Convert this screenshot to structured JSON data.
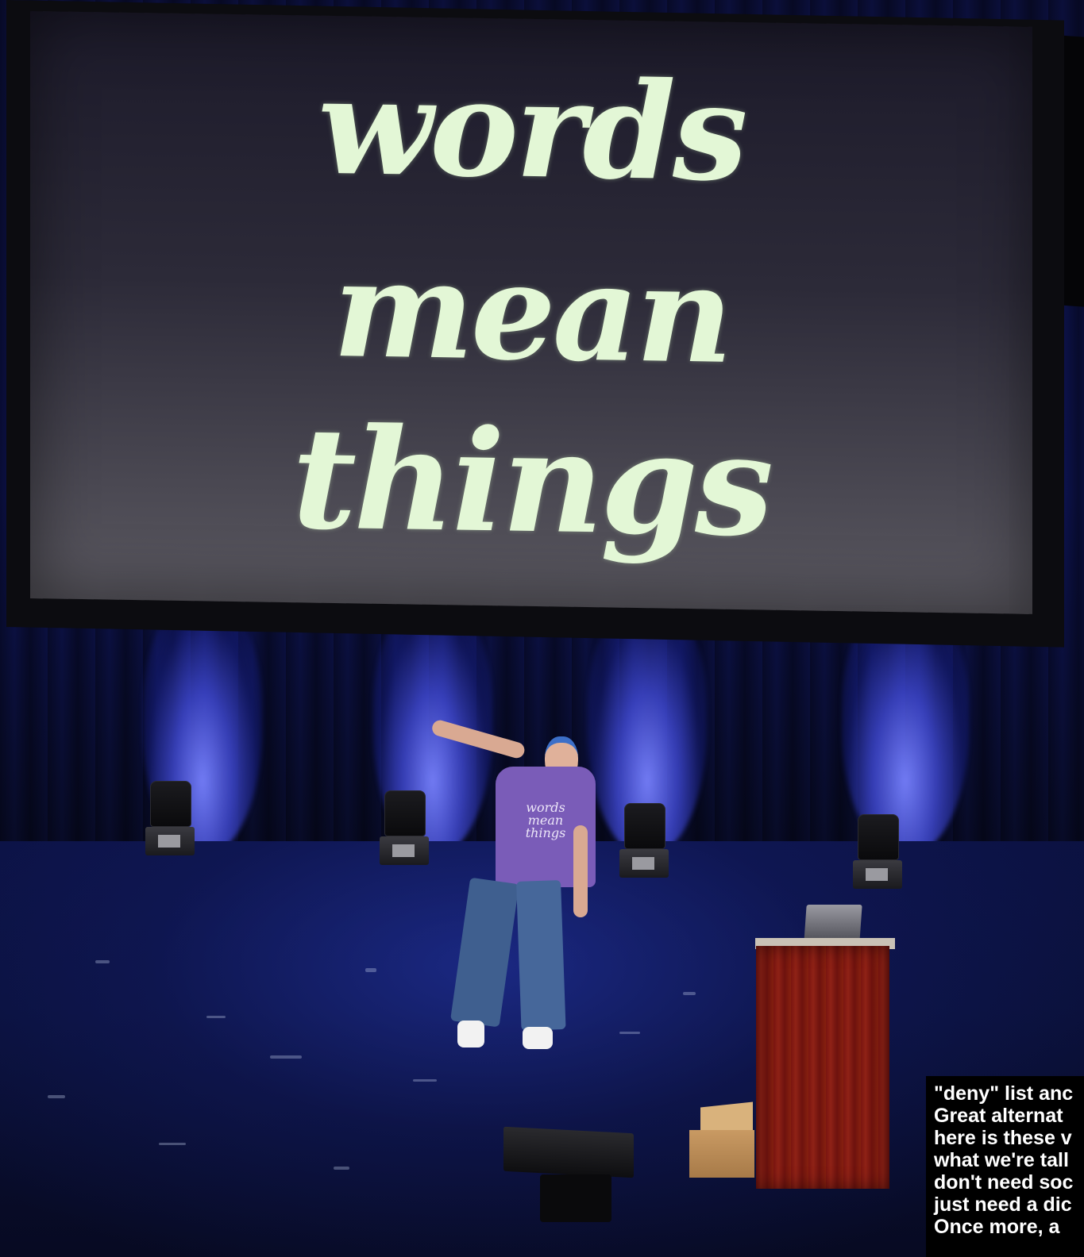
{
  "slide": {
    "lines": [
      "words",
      "mean",
      "things"
    ],
    "text_color": "#e3f7d6"
  },
  "shirt": {
    "lines": [
      "words",
      "mean",
      "things"
    ],
    "color": "#7a5cb8"
  },
  "captions": {
    "lines": [
      "\"deny\" list anc",
      "Great alternat",
      "here is these v",
      "what we're tall",
      "don't need soc",
      "just need a dic",
      "Once more, a"
    ]
  },
  "colors": {
    "curtain_light": "#4a55e6",
    "podium": "#8f2216",
    "floor": "#0a1038"
  }
}
